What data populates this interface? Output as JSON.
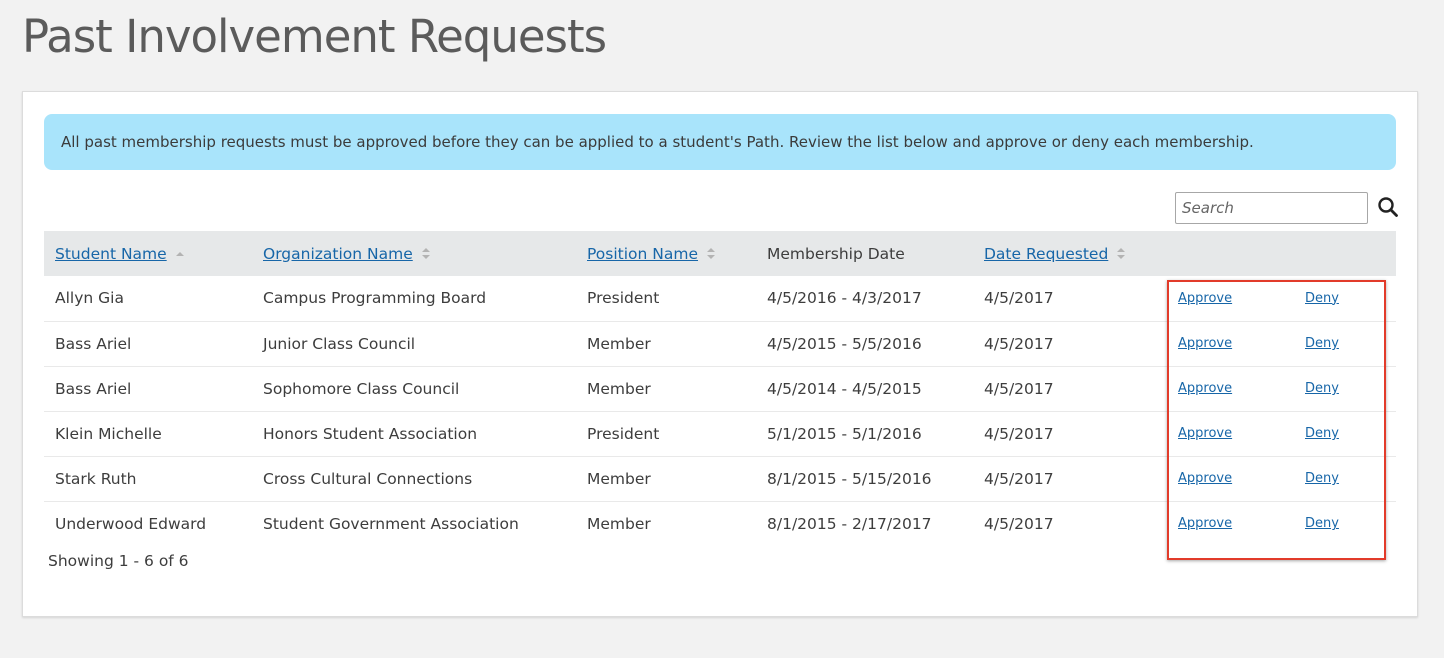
{
  "page": {
    "title": "Past Involvement Requests"
  },
  "alert": {
    "text": "All past membership requests must be approved before they can be applied to a student's Path. Review the list below and approve or deny each membership."
  },
  "search": {
    "placeholder": "Search",
    "icon": "search-icon"
  },
  "table": {
    "headers": {
      "student_name": "Student Name",
      "organization_name": "Organization Name",
      "position_name": "Position Name",
      "membership_date": "Membership Date",
      "date_requested": "Date Requested"
    },
    "rows": [
      {
        "student": "Allyn Gia",
        "organization": "Campus Programming Board",
        "position": "President",
        "membership_date": "4/5/2016 - 4/3/2017",
        "date_requested": "4/5/2017",
        "approve": "Approve",
        "deny": "Deny"
      },
      {
        "student": "Bass Ariel",
        "organization": "Junior Class Council",
        "position": "Member",
        "membership_date": "4/5/2015 - 5/5/2016",
        "date_requested": "4/5/2017",
        "approve": "Approve",
        "deny": "Deny"
      },
      {
        "student": "Bass Ariel",
        "organization": "Sophomore Class Council",
        "position": "Member",
        "membership_date": "4/5/2014 - 4/5/2015",
        "date_requested": "4/5/2017",
        "approve": "Approve",
        "deny": "Deny"
      },
      {
        "student": "Klein Michelle",
        "organization": "Honors Student Association",
        "position": "President",
        "membership_date": "5/1/2015 - 5/1/2016",
        "date_requested": "4/5/2017",
        "approve": "Approve",
        "deny": "Deny"
      },
      {
        "student": "Stark Ruth",
        "organization": "Cross Cultural Connections",
        "position": "Member",
        "membership_date": "8/1/2015 - 5/15/2016",
        "date_requested": "4/5/2017",
        "approve": "Approve",
        "deny": "Deny"
      },
      {
        "student": "Underwood Edward",
        "organization": "Student Government Association",
        "position": "Member",
        "membership_date": "8/1/2015 - 2/17/2017",
        "date_requested": "4/5/2017",
        "approve": "Approve",
        "deny": "Deny"
      }
    ]
  },
  "footer": {
    "showing": "Showing 1 - 6 of 6"
  },
  "colors": {
    "background": "#f2f2f2",
    "alert_background": "#a9e4fb",
    "link": "#1766a8",
    "header_row": "#e6e8e9",
    "highlight_border": "#e23b2a"
  }
}
